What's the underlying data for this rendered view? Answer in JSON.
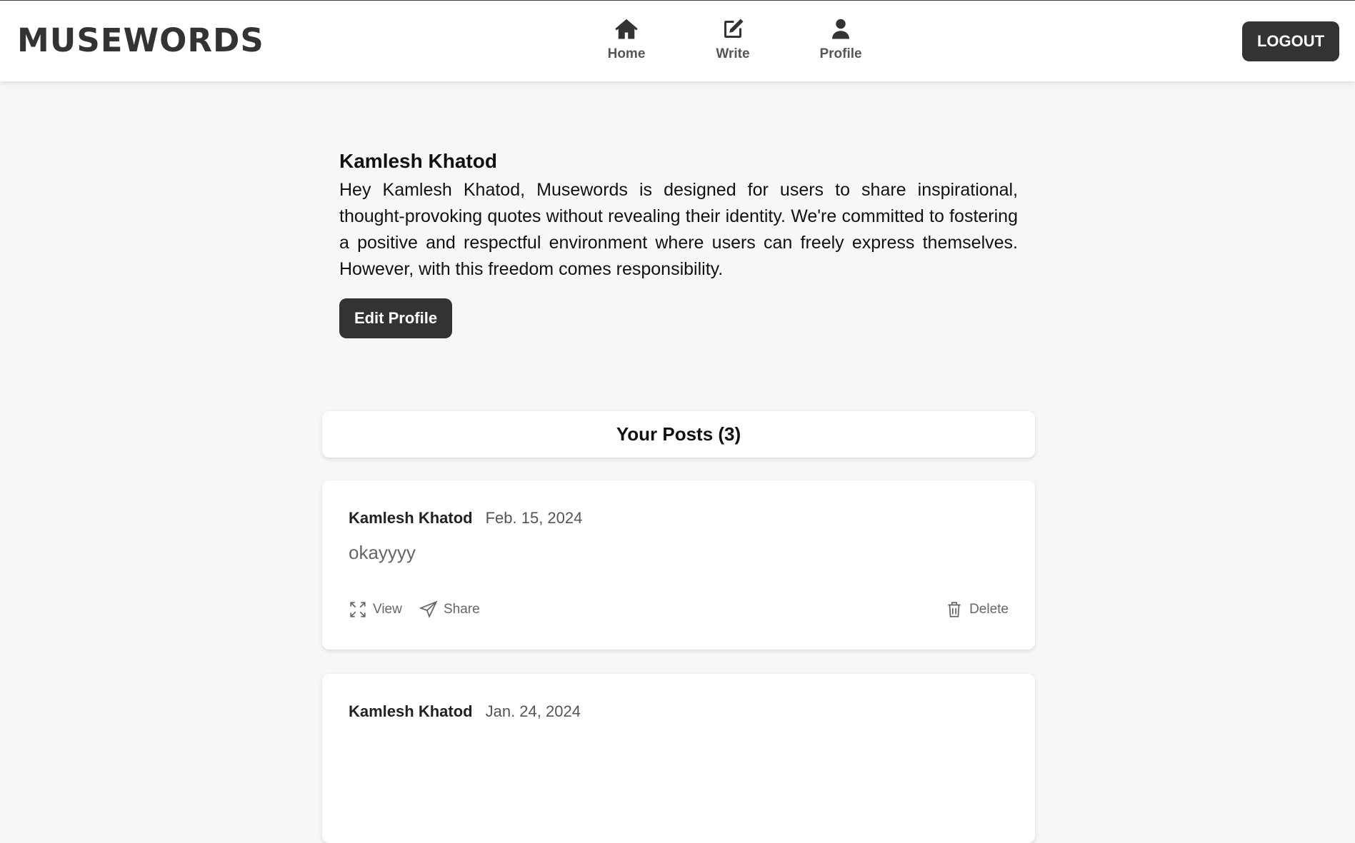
{
  "app": {
    "logo": "MUSEWORDS"
  },
  "nav": {
    "items": [
      {
        "label": "Home",
        "icon": "home-icon"
      },
      {
        "label": "Write",
        "icon": "edit-icon"
      },
      {
        "label": "Profile",
        "icon": "user-icon"
      }
    ],
    "logout_label": "LOGOUT"
  },
  "profile": {
    "name": "Kamlesh Khatod",
    "bio": "Hey Kamlesh Khatod, Musewords is designed for users to share inspirational, thought-provoking quotes without revealing their identity. We're committed to fostering a positive and respectful environment where users can freely express themselves. However, with this freedom comes responsibility.",
    "edit_label": "Edit Profile"
  },
  "posts": {
    "header": "Your Posts (3)",
    "items": [
      {
        "author": "Kamlesh Khatod",
        "date": "Feb. 15, 2024",
        "text": "okayyyy"
      },
      {
        "author": "Kamlesh Khatod",
        "date": "Jan. 24, 2024",
        "text": ""
      }
    ],
    "actions": {
      "view": "View",
      "share": "Share",
      "delete": "Delete"
    }
  },
  "colors": {
    "primary": "#333333",
    "background": "#f7f7f7"
  }
}
